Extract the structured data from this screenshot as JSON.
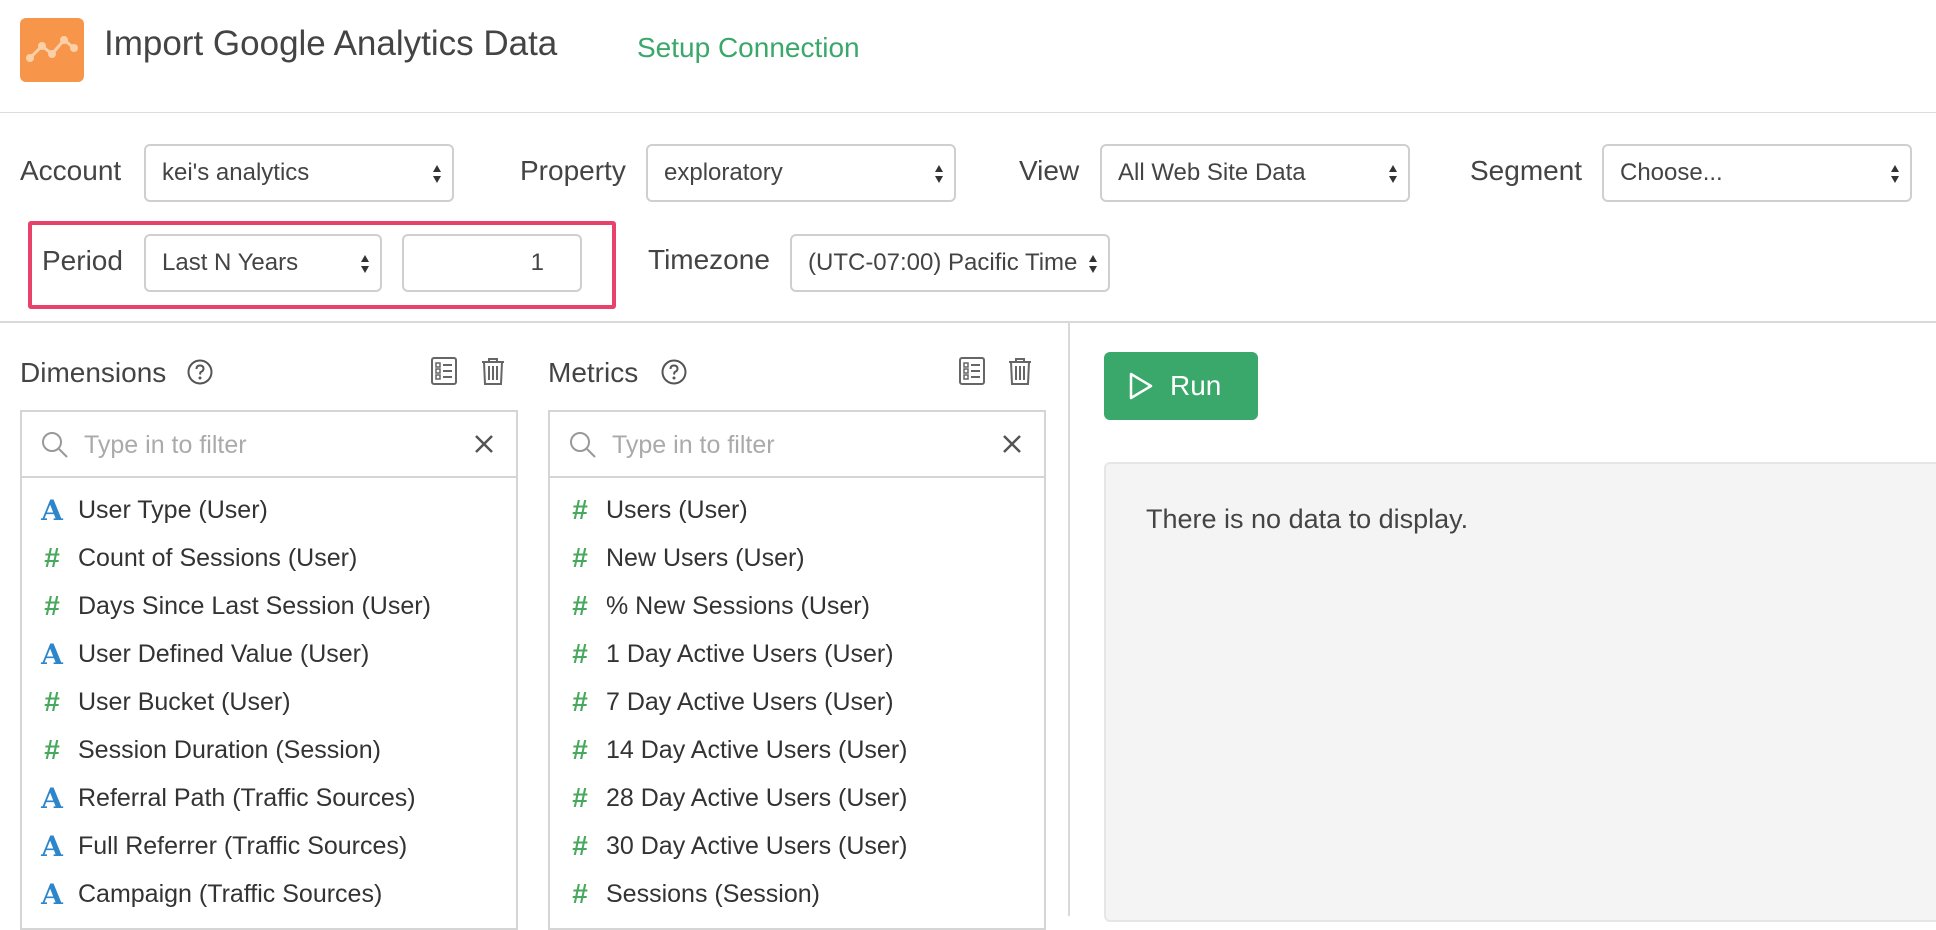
{
  "header": {
    "title": "Import Google Analytics Data",
    "setup_link": "Setup Connection",
    "logo_icon": "chart-line-icon",
    "logo_color": "#f7964a"
  },
  "filters": {
    "account_label": "Account",
    "account_value": "kei's analytics",
    "property_label": "Property",
    "property_value": "exploratory",
    "view_label": "View",
    "view_value": "All Web Site Data",
    "segment_label": "Segment",
    "segment_value": "Choose...",
    "period_label": "Period",
    "period_value": "Last N Years",
    "period_n": "1",
    "timezone_label": "Timezone",
    "timezone_value": "(UTC-07:00) Pacific Time"
  },
  "dimensions": {
    "title": "Dimensions",
    "filter_placeholder": "Type in to filter",
    "items": [
      {
        "type": "A",
        "label": "User Type (User)"
      },
      {
        "type": "#",
        "label": "Count of Sessions (User)"
      },
      {
        "type": "#",
        "label": "Days Since Last Session (User)"
      },
      {
        "type": "A",
        "label": "User Defined Value (User)"
      },
      {
        "type": "#",
        "label": "User Bucket (User)"
      },
      {
        "type": "#",
        "label": "Session Duration (Session)"
      },
      {
        "type": "A",
        "label": "Referral Path (Traffic Sources)"
      },
      {
        "type": "A",
        "label": "Full Referrer (Traffic Sources)"
      },
      {
        "type": "A",
        "label": "Campaign (Traffic Sources)"
      }
    ]
  },
  "metrics": {
    "title": "Metrics",
    "filter_placeholder": "Type in to filter",
    "items": [
      {
        "type": "#",
        "label": "Users (User)"
      },
      {
        "type": "#",
        "label": "New Users (User)"
      },
      {
        "type": "#",
        "label": "% New Sessions (User)"
      },
      {
        "type": "#",
        "label": "1 Day Active Users (User)"
      },
      {
        "type": "#",
        "label": "7 Day Active Users (User)"
      },
      {
        "type": "#",
        "label": "14 Day Active Users (User)"
      },
      {
        "type": "#",
        "label": "28 Day Active Users (User)"
      },
      {
        "type": "#",
        "label": "30 Day Active Users (User)"
      },
      {
        "type": "#",
        "label": "Sessions (Session)"
      }
    ]
  },
  "run": {
    "label": "Run",
    "color": "#3aa86a"
  },
  "result": {
    "empty_message": "There is no data to display."
  },
  "colors": {
    "highlight": "#e8416a",
    "text_type": "#2d86c9",
    "numeric_type": "#49a85e"
  }
}
